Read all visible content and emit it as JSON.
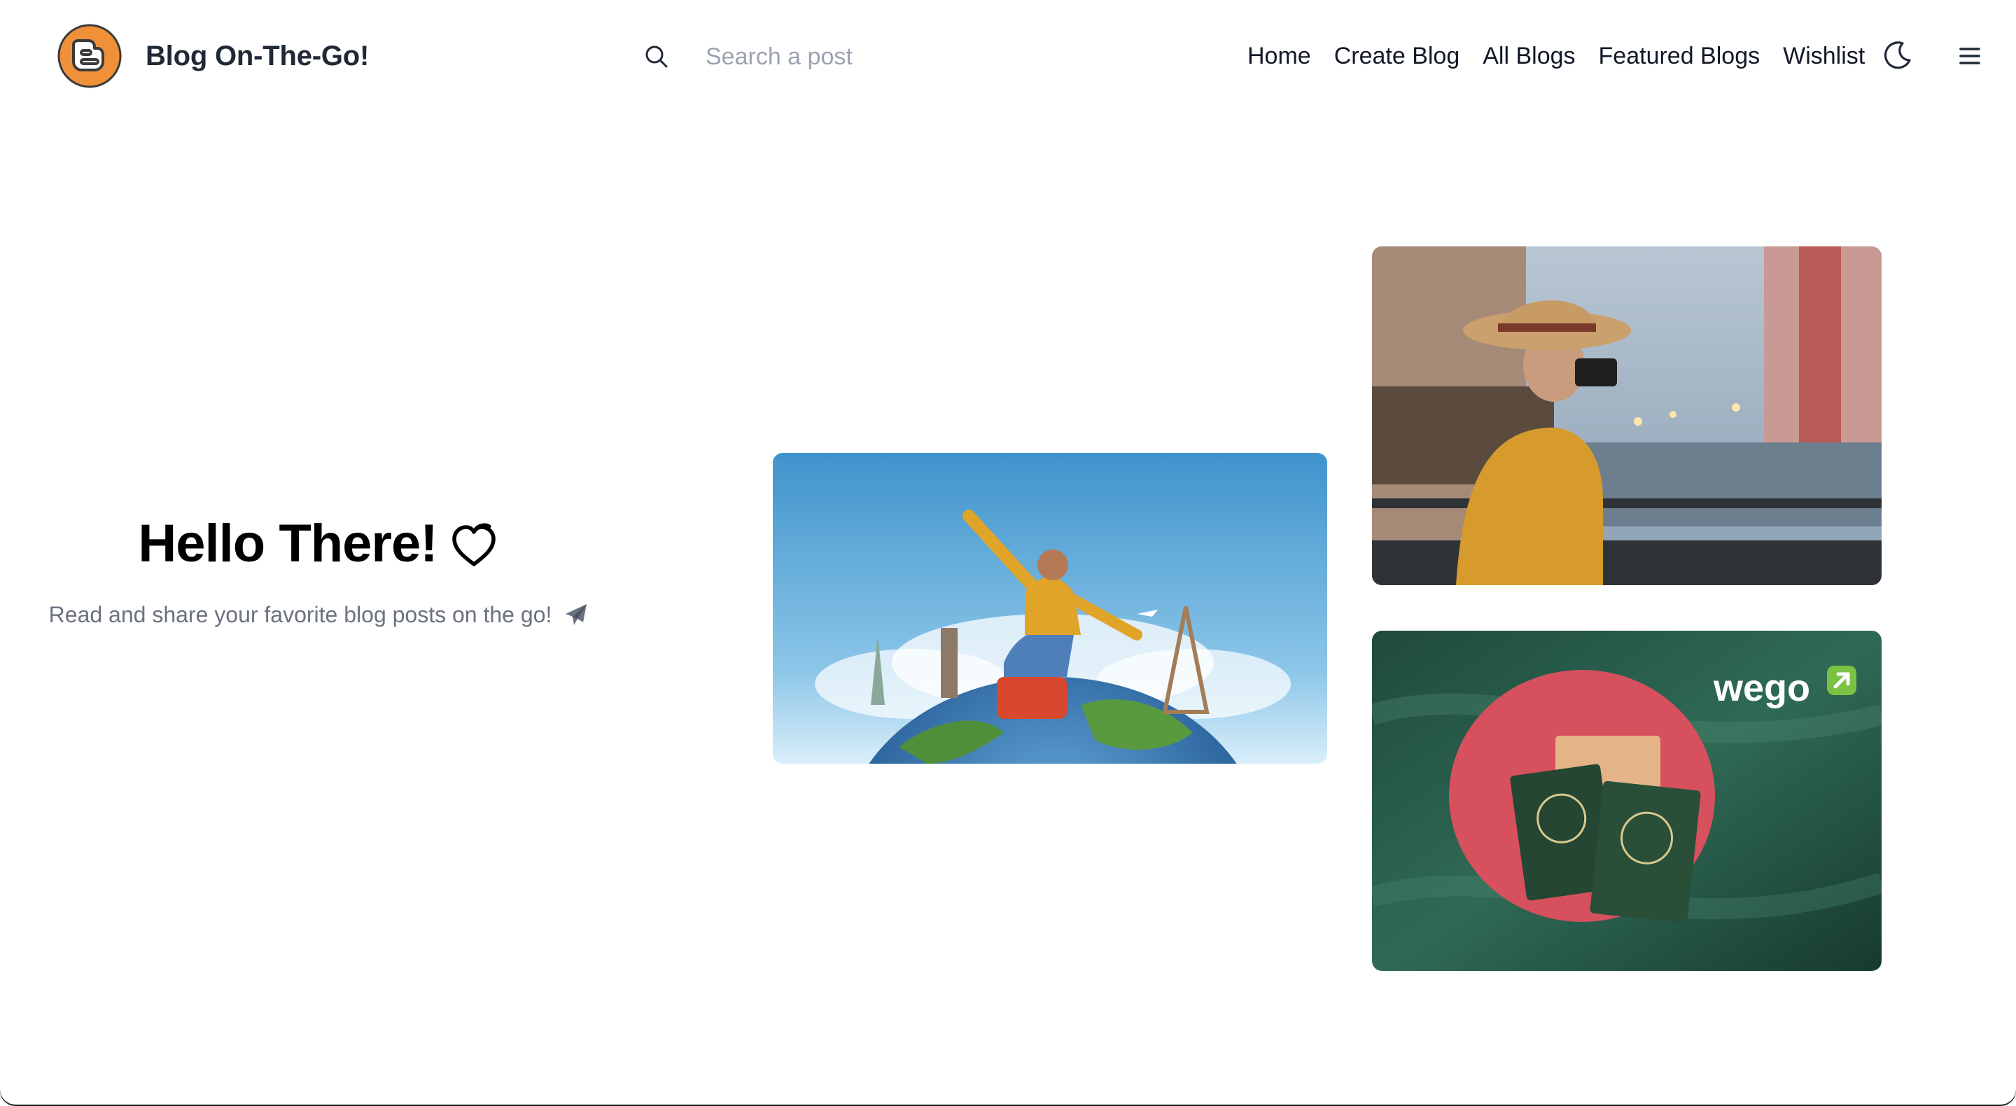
{
  "brand": {
    "title": "Blog On-The-Go!",
    "logo_icon": "blogger-logo-icon",
    "logo_color": "#F0913A"
  },
  "search": {
    "placeholder": "Search a post",
    "value": "",
    "icon": "search-icon"
  },
  "nav": {
    "items": [
      {
        "label": "Home"
      },
      {
        "label": "Create Blog"
      },
      {
        "label": "All Blogs"
      },
      {
        "label": "Featured Blogs"
      },
      {
        "label": "Wishlist"
      }
    ],
    "theme_toggle_icon": "moon-icon",
    "menu_icon": "hamburger-menu-icon"
  },
  "hero": {
    "title": "Hello There!",
    "title_icon": "heart-icon",
    "subtitle": "Read and share your favorite blog posts on the go!",
    "subtitle_icon": "paper-plane-icon"
  },
  "cards": [
    {
      "name": "travel-girl-globe-image"
    },
    {
      "name": "photographer-canal-image"
    },
    {
      "name": "bangladesh-passport-wego-image",
      "brand_text": "wego"
    }
  ],
  "colors": {
    "text_primary": "#1f2937",
    "text_muted": "#6b7280",
    "placeholder": "#9ca3af"
  }
}
